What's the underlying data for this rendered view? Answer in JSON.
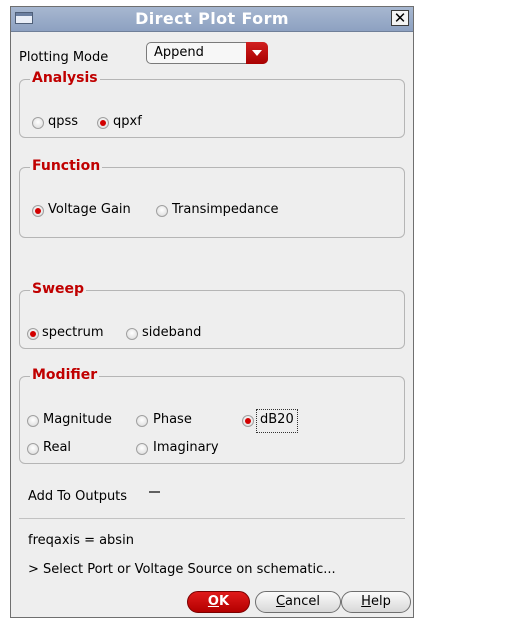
{
  "window": {
    "title": "Direct Plot Form"
  },
  "plotting_mode": {
    "label": "Plotting Mode",
    "selected": "Append"
  },
  "analysis": {
    "title": "Analysis",
    "options": [
      {
        "label": "qpss",
        "checked": false
      },
      {
        "label": "qpxf",
        "checked": true
      }
    ]
  },
  "function": {
    "title": "Function",
    "options": [
      {
        "label": "Voltage Gain",
        "checked": true
      },
      {
        "label": "Transimpedance",
        "checked": false
      }
    ]
  },
  "sweep": {
    "title": "Sweep",
    "options": [
      {
        "label": "spectrum",
        "checked": true
      },
      {
        "label": "sideband",
        "checked": false
      }
    ]
  },
  "modifier": {
    "title": "Modifier",
    "options": [
      {
        "label": "Magnitude",
        "checked": false
      },
      {
        "label": "Phase",
        "checked": false
      },
      {
        "label": "dB20",
        "checked": true
      },
      {
        "label": "Real",
        "checked": false
      },
      {
        "label": "Imaginary",
        "checked": false
      }
    ]
  },
  "add_to_outputs": {
    "label": "Add To Outputs",
    "checked": false
  },
  "status": {
    "freqaxis": "freqaxis = absin",
    "prompt": "> Select Port or Voltage Source on schematic..."
  },
  "buttons": {
    "ok": {
      "mnemonic": "O",
      "rest": "K"
    },
    "cancel": {
      "mnemonic": "C",
      "rest": "ancel"
    },
    "help": {
      "mnemonic": "H",
      "rest": "elp"
    }
  }
}
